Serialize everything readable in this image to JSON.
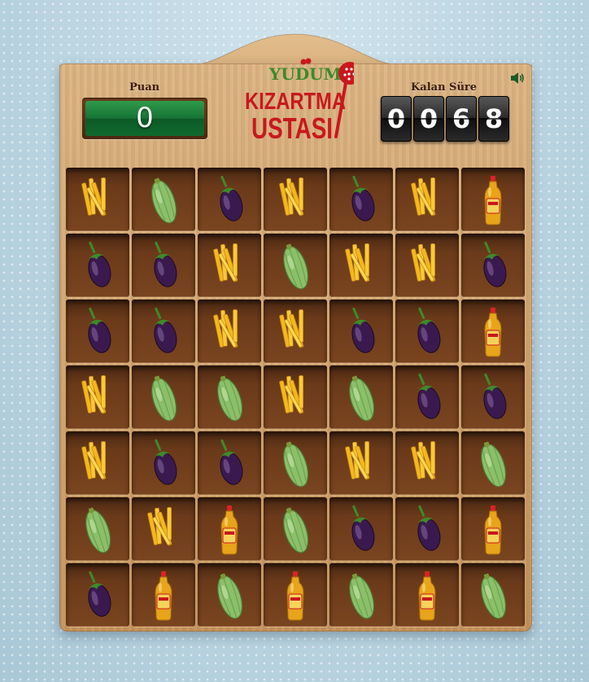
{
  "game": {
    "brand": "YUDUM",
    "title_line1": "KIZARTMA",
    "title_line2": "USTASI",
    "score_label": "Puan",
    "score": "0",
    "time_label": "Kalan Süre",
    "time_digits": [
      "0",
      "0",
      "6",
      "8"
    ],
    "sound_icon": "speaker-icon"
  },
  "colors": {
    "score_green": "#167334",
    "title_red": "#c8181e",
    "brand_green": "#3d8a2a",
    "wood": "#d2a772"
  },
  "grid": {
    "rows": 7,
    "cols": 7,
    "cells": [
      [
        "fries",
        "zucchini",
        "eggplant",
        "fries",
        "eggplant",
        "fries",
        "oil"
      ],
      [
        "eggplant",
        "eggplant",
        "fries",
        "zucchini",
        "fries",
        "fries",
        "eggplant"
      ],
      [
        "eggplant",
        "eggplant",
        "fries",
        "fries",
        "eggplant",
        "eggplant",
        "oil"
      ],
      [
        "fries",
        "zucchini",
        "zucchini",
        "fries",
        "zucchini",
        "eggplant",
        "eggplant"
      ],
      [
        "fries",
        "eggplant",
        "eggplant",
        "zucchini",
        "fries",
        "fries",
        "zucchini"
      ],
      [
        "zucchini",
        "fries",
        "oil",
        "zucchini",
        "eggplant",
        "eggplant",
        "oil"
      ],
      [
        "eggplant",
        "oil",
        "zucchini",
        "oil",
        "zucchini",
        "oil",
        "zucchini"
      ]
    ]
  }
}
